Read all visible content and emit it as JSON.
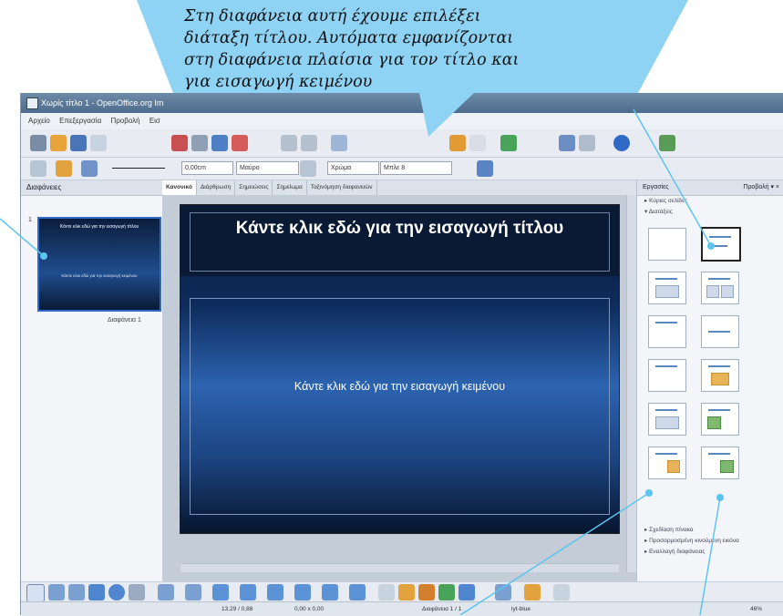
{
  "window": {
    "title": "Χωρίς τίτλο 1 - OpenOffice.org Im",
    "menu": [
      "Αρχείο",
      "Επεξεργασία",
      "Προβολή",
      "Εισ"
    ]
  },
  "slides_pane": {
    "header": "Διαφάνειες",
    "thumbnail_number": "1",
    "thumbnail_title": "Κάντε κλικ εδώ για την εισαγωγή τίτλου",
    "thumbnail_body": "Κάντε κλικ εδώ για την εισαγωγή κειμένου",
    "thumbnail_caption": "Διαφάνεια 1"
  },
  "view_tabs": [
    "Κανονικό",
    "Διάρθρωση",
    "Σημειώσεις",
    "Σημείωμα",
    "Ταξινόμηση διαφανειών"
  ],
  "slide": {
    "title": "Κάντε κλικ εδώ για την εισαγωγή τίτλου",
    "body": "Κάντε κλικ εδώ για την εισαγωγή κειμένου"
  },
  "tasks_pane": {
    "header": "Εργασίες",
    "view_menu": "Προβολή ▾ ×",
    "master_pages": "▸ Κύριες σελίδες",
    "layouts": "▾ Διατάξεις",
    "footer_sections": [
      "▸ Σχεδίαση πίνακα",
      "▸ Προσαρμοσμένη κινούμενη εικόνα",
      "▸ Εναλλαγή διαφάνειας"
    ]
  },
  "formatting": {
    "line_width": "0,00cm",
    "color": "Μαύρο",
    "fill": "Χρώμα",
    "fill_color": "Μπλε 8"
  },
  "status": {
    "position": "13.29 / 0,88",
    "size": "0,00 x 0,00",
    "slide": "Διαφάνεια 1 / 1",
    "layout": "lyt-blue",
    "zoom": "46%"
  },
  "annotation": {
    "lines": [
      "Στη διαφάνεια αυτή έχουμε επιλέξει",
      "διάταξη τίτλου. Αυτόματα εμφανίζονται",
      "στη διαφάνεια πλαίσια για τον τίτλο και",
      "για εισαγωγή κειμένου"
    ],
    "bubble_color": "#8fd3f4",
    "leader_color": "#5cc5ef"
  }
}
